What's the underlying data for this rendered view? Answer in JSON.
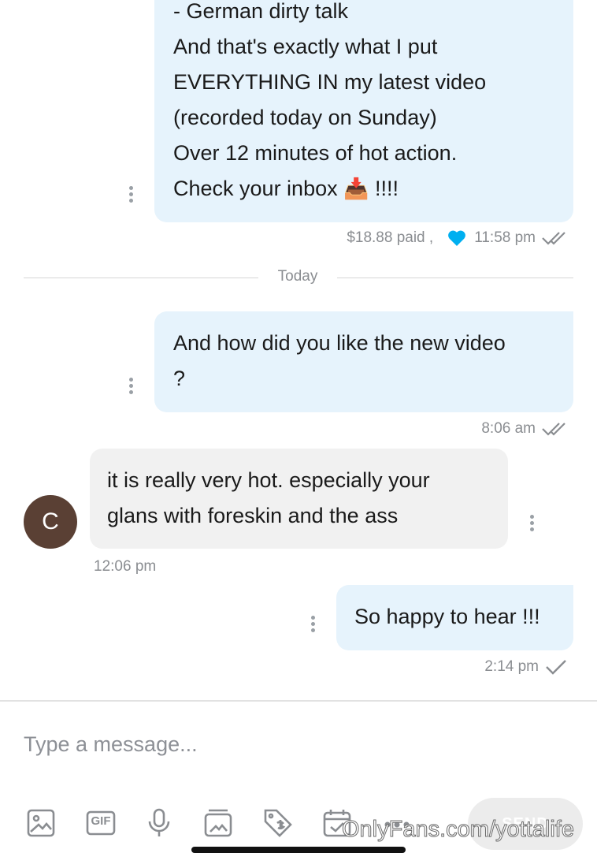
{
  "messages": [
    {
      "lines": [
        "- German dirty talk",
        "And that's exactly what I put",
        "EVERYTHING IN my latest video",
        "(recorded today on Sunday)",
        "Over 12 minutes of hot action.",
        "Check your inbox",
        "!!!!"
      ],
      "emoji": "📥",
      "paid": "$18.88 paid ,",
      "time": "11:58 pm"
    },
    {
      "lines": [
        "And how did you like the new video",
        "?"
      ],
      "time": "8:06 am"
    },
    {
      "lines": [
        "it is really very hot. especially your",
        "glans with foreskin and the ass"
      ],
      "avatar_letter": "C",
      "time": "12:06 pm"
    },
    {
      "lines": [
        "So happy to hear !!!"
      ],
      "time": "2:14 pm"
    }
  ],
  "divider": "Today",
  "composer": {
    "placeholder": "Type a message...",
    "send_label": "SEND"
  },
  "toolbar": [
    "image-icon",
    "gif-icon",
    "microphone-icon",
    "media-vault-icon",
    "price-tag-icon",
    "schedule-icon",
    "more-icon"
  ],
  "toolbar_gif_label": "GIF",
  "watermark": "OnlyFans.com/yottalife",
  "colors": {
    "outgoing_bubble": "#e6f3fc",
    "incoming_bubble": "#f1f1f1",
    "heart": "#00aff0",
    "avatar": "#5a4034"
  }
}
